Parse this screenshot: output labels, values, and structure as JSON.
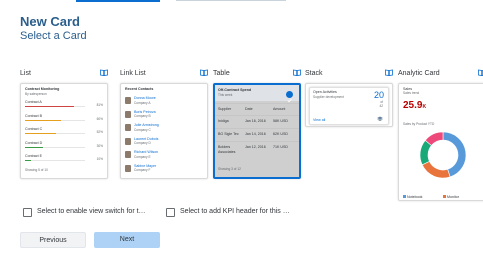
{
  "header": {
    "title": "New Card",
    "subtitle": "Select a Card"
  },
  "cards": [
    {
      "label": "List",
      "list": {
        "title": "Contract Monitoring",
        "subtitle": "By salesperson",
        "items": [
          {
            "name": "Contract A",
            "value": "81%",
            "progress": 0.81,
            "color": "#d04343"
          },
          {
            "name": "Contract B",
            "value": "60%",
            "progress": 0.6,
            "color": "#e5a01d"
          },
          {
            "name": "Contract C",
            "value": "52%",
            "progress": 0.52,
            "color": "#e5a01d"
          },
          {
            "name": "Contract D",
            "value": "30%",
            "progress": 0.3,
            "color": "#3b9a44"
          },
          {
            "name": "Contract E",
            "value": "10%",
            "progress": 0.1,
            "color": "#3b9a44"
          }
        ],
        "footer": "Showing 5 of 10"
      }
    },
    {
      "label": "Link List",
      "linklist": {
        "title": "Recent Contacts",
        "items": [
          {
            "name": "Donna Moore",
            "company": "Company A"
          },
          {
            "name": "Boris Petrova",
            "company": "Company B"
          },
          {
            "name": "Julie Armstrong",
            "company": "Company C"
          },
          {
            "name": "Laurent Dubois",
            "company": "Company D"
          },
          {
            "name": "Richard Wilson",
            "company": "Company E"
          },
          {
            "name": "Sabine Mayer",
            "company": "Company F"
          }
        ]
      }
    },
    {
      "label": "Table",
      "table": {
        "title": "Off-Contract Spend",
        "subtitle": "This week",
        "headers": [
          "Supplier",
          "Date",
          "Amount"
        ],
        "rows": [
          [
            "Inidiga",
            "Jan 16, 2016",
            "58K USD"
          ],
          [
            "BG Sigle Tec",
            "Jan 14, 2016",
            "62K USD"
          ],
          [
            "Bolders Associates",
            "Jan 12, 2016",
            "71K USD"
          ]
        ],
        "footer": "Showing 3 of 12"
      }
    },
    {
      "label": "Stack",
      "stack": {
        "title": "Open Activities",
        "subtitle": "Supplier development",
        "big_number": "20",
        "big_sub_1": "of",
        "big_sub_2": "42",
        "footer": "View all"
      }
    },
    {
      "label": "Analytic Card",
      "analytic": {
        "title": "Sales",
        "subtitle": "Sales trend",
        "value": "25.9",
        "unit": "K",
        "chart_title": "Sales by Product YTD",
        "legend": [
          "Notebook",
          "Monitor",
          "Mouse",
          "Others"
        ]
      }
    }
  ],
  "options": {
    "view_switch": "Select to enable view switch for t…",
    "kpi_header": "Select to add KPI header for this …"
  },
  "buttons": {
    "previous": "Previous",
    "next": "Next"
  },
  "chart_data": {
    "type": "pie",
    "categories": [
      "Notebook",
      "Monitor",
      "Mouse",
      "Others"
    ],
    "values": [
      45,
      23,
      18,
      14
    ],
    "colors": [
      "#5899da",
      "#e8743b",
      "#19a979",
      "#ed4a7b"
    ]
  },
  "colors": {
    "accent": "#0a6ed1",
    "title": "#2a5e8c",
    "next_button": "#aed2f5"
  }
}
